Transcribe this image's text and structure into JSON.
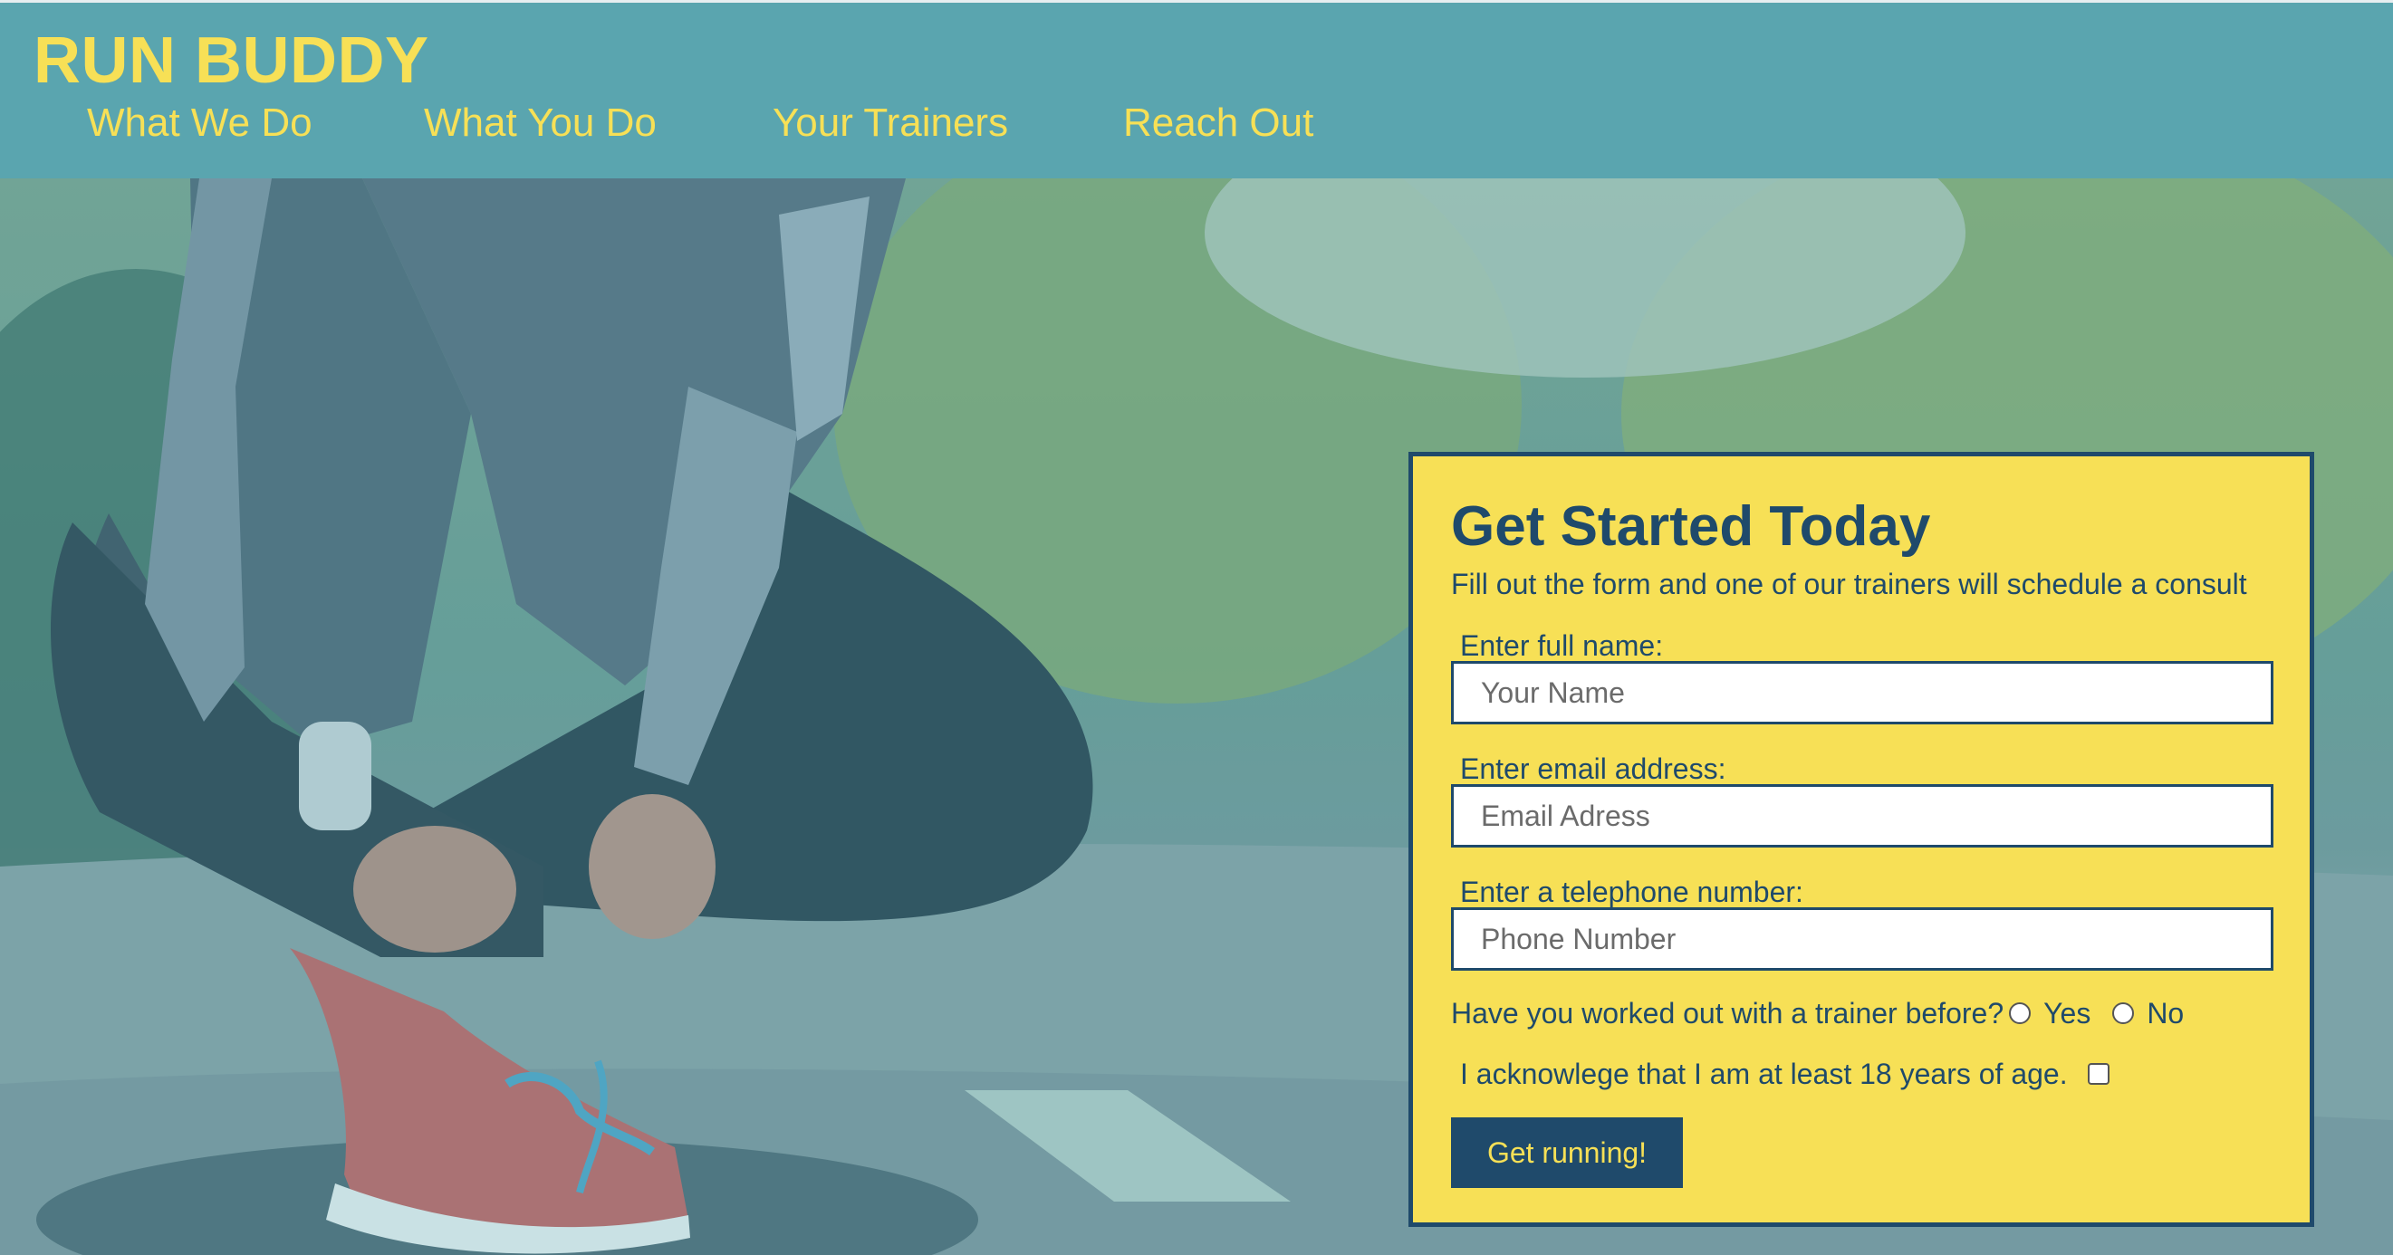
{
  "header": {
    "brand": "RUN BUDDY",
    "nav": [
      "What We Do",
      "What You Do",
      "Your Trainers",
      "Reach Out"
    ]
  },
  "form": {
    "title": "Get Started Today",
    "subtitle": "Fill out the form and one of our trainers will schedule a consult",
    "name_label": "Enter full name:",
    "name_placeholder": "Your Name",
    "email_label": "Enter email address:",
    "email_placeholder": "Email Adress",
    "phone_label": "Enter a telephone number:",
    "phone_placeholder": "Phone Number",
    "trainer_question": "Have you worked out with a trainer before?",
    "option_yes": "Yes",
    "option_no": "No",
    "age_ack": "I acknowlege that I am at least 18 years of age.",
    "submit_label": "Get running!"
  },
  "colors": {
    "header_bg": "#5aa5af",
    "accent_yellow": "#f7e056",
    "navy": "#1f4a6b"
  },
  "hero": {
    "image": "runner-tying-shoe-photo"
  }
}
